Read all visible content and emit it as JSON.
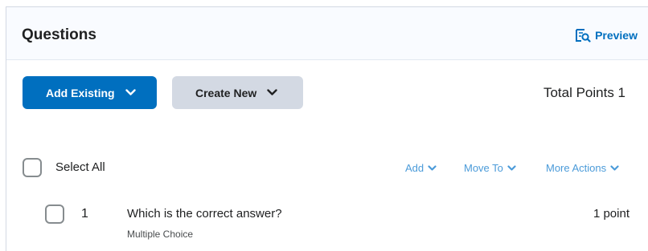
{
  "header": {
    "title": "Questions",
    "preview_label": "Preview",
    "preview_icon": "document-search-icon"
  },
  "toolbar": {
    "add_existing_label": "Add Existing",
    "create_new_label": "Create New",
    "total_points": "Total Points 1"
  },
  "list_actions": {
    "select_all_label": "Select All",
    "select_all_checked": false,
    "add_label": "Add",
    "move_to_label": "Move To",
    "more_actions_label": "More Actions"
  },
  "questions": [
    {
      "number": "1",
      "text": "Which is the correct answer?",
      "type": "Multiple Choice",
      "points": "1 point",
      "checked": false
    }
  ],
  "colors": {
    "primary": "#006fbf",
    "secondary_button": "#d3d9e3",
    "action_link": "#4b9bd9",
    "header_bg": "#f9fbff"
  }
}
